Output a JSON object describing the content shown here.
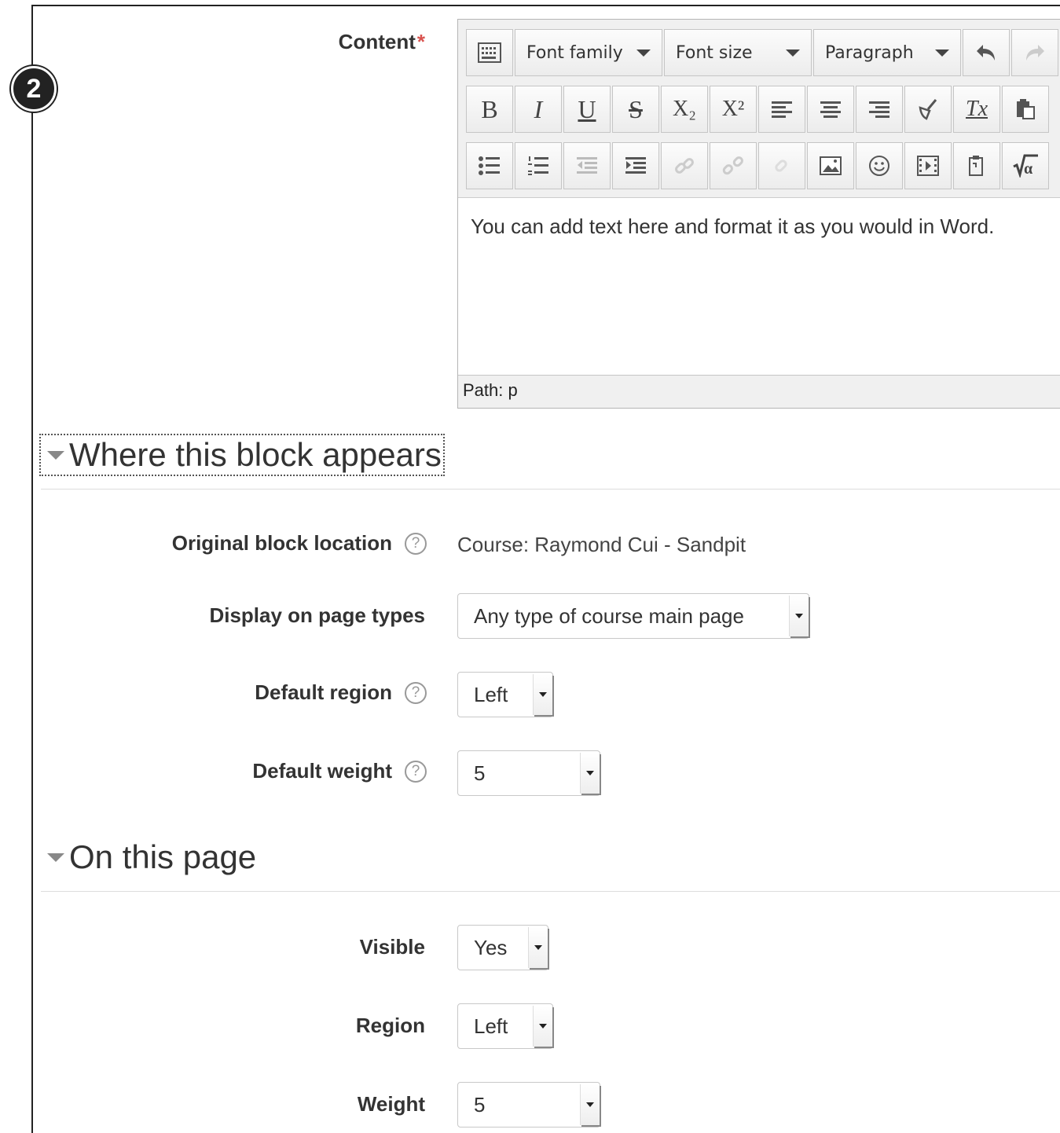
{
  "step_badge": "2",
  "content_field": {
    "label": "Content",
    "required_marker": "*",
    "toolbar": {
      "font_family": "Font family",
      "font_size": "Font size",
      "paragraph": "Paragraph",
      "row2": [
        "B",
        "I",
        "U",
        "S",
        "X₂",
        "X²"
      ],
      "icons_row1": [
        "toolbar-toggle-icon",
        "undo-icon",
        "redo-icon"
      ],
      "icons_row2": [
        "align-left-icon",
        "align-center-icon",
        "align-right-icon",
        "brush-icon",
        "clear-format-icon",
        "paste-icon"
      ],
      "icons_row3": [
        "bullet-list-icon",
        "numbered-list-icon",
        "outdent-icon",
        "indent-icon",
        "link-icon",
        "unlink-icon",
        "anchor-icon",
        "image-icon",
        "emoticon-icon",
        "media-icon",
        "paste-word-icon",
        "equation-icon"
      ]
    },
    "text": "You can add text here and format it as you would in Word.",
    "path": "Path: p"
  },
  "sections": {
    "where": "Where this block appears",
    "on_page": "On this page"
  },
  "where": {
    "original_location_label": "Original block location",
    "original_location_value": "Course: Raymond Cui - Sandpit",
    "display_label": "Display on page types",
    "display_value": "Any type of course main page",
    "region_label": "Default region",
    "region_value": "Left",
    "weight_label": "Default weight",
    "weight_value": "5"
  },
  "on_page": {
    "visible_label": "Visible",
    "visible_value": "Yes",
    "region_label": "Region",
    "region_value": "Left",
    "weight_label": "Weight",
    "weight_value": "5"
  },
  "help_glyph": "?"
}
